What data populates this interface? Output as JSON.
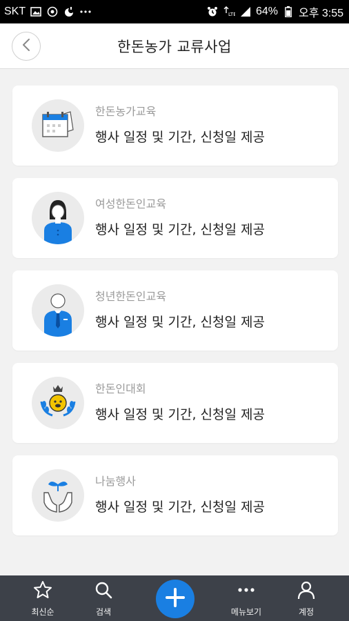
{
  "status_bar": {
    "carrier": "SKT",
    "battery_percent": "64%",
    "time": "오후 3:55",
    "icons": [
      "gallery-icon",
      "location-icon",
      "moon-icon",
      "more-dots",
      "alarm-icon",
      "lte-icon",
      "signal-icon",
      "battery-icon"
    ]
  },
  "header": {
    "title": "한돈농가 교류사업",
    "back_icon": "chevron-left-icon"
  },
  "cards": [
    {
      "title": "한돈농가교육",
      "desc": "행사 일정 및 기간, 신청일 제공",
      "icon": "calendar-icon"
    },
    {
      "title": "여성한돈인교육",
      "desc": "행사 일정 및 기간, 신청일 제공",
      "icon": "woman-icon"
    },
    {
      "title": "청년한돈인교육",
      "desc": "행사 일정 및 기간, 신청일 제공",
      "icon": "man-icon"
    },
    {
      "title": "한돈인대회",
      "desc": "행사 일정 및 기간, 신청일 제공",
      "icon": "trophy-emblem-icon"
    },
    {
      "title": "나눔행사",
      "desc": "행사 일정 및 기간, 신청일 제공",
      "icon": "sharing-hands-icon"
    }
  ],
  "bottom_nav": {
    "items": [
      {
        "label": "최신순",
        "icon": "star-icon"
      },
      {
        "label": "검색",
        "icon": "search-icon"
      },
      {
        "label": "메뉴보기",
        "icon": "more-icon"
      },
      {
        "label": "계정",
        "icon": "account-icon"
      }
    ],
    "center_icon": "plus-icon",
    "accent_color": "#1a7fe2",
    "bar_color": "#3d4149"
  }
}
